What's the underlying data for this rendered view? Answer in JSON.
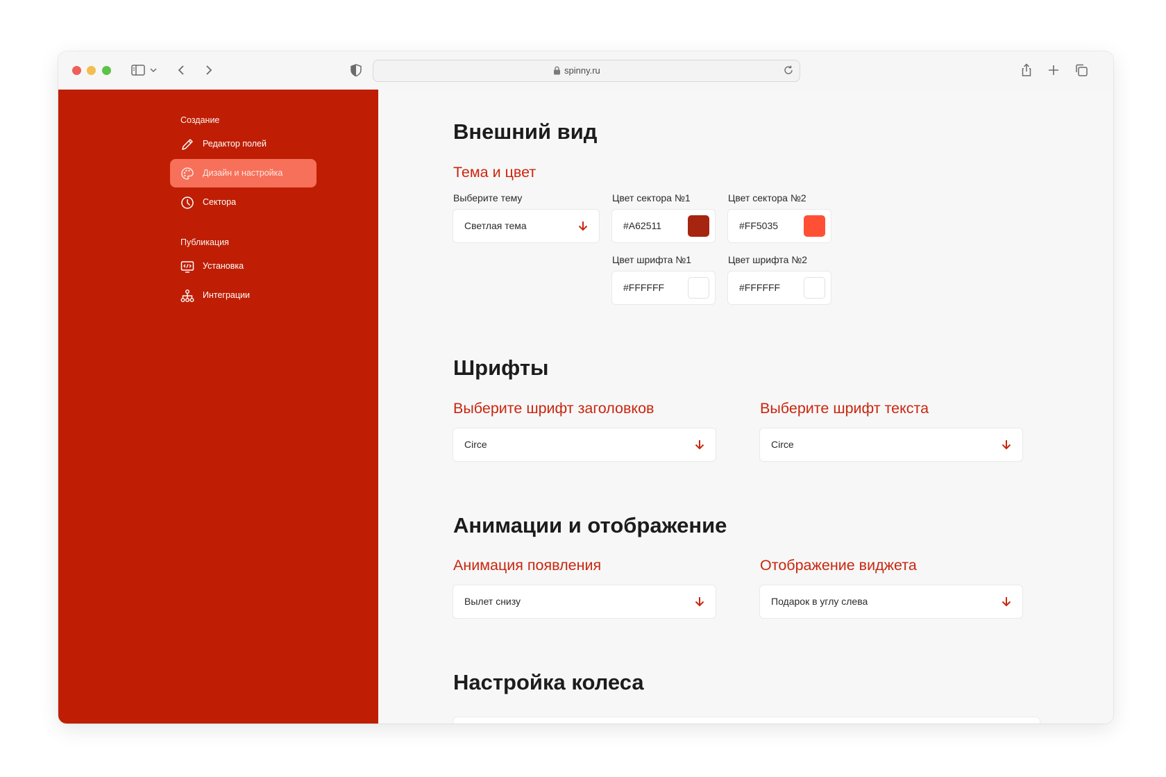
{
  "browser": {
    "url": "spinny.ru"
  },
  "sidebar": {
    "sections": [
      {
        "title": "Создание",
        "items": [
          {
            "label": "Редактор полей",
            "icon": "pencil-icon",
            "active": false
          },
          {
            "label": "Дизайн и настройка",
            "icon": "palette-icon",
            "active": true
          },
          {
            "label": "Сектора",
            "icon": "clock-icon",
            "active": false
          }
        ]
      },
      {
        "title": "Публикация",
        "items": [
          {
            "label": "Установка",
            "icon": "code-monitor-icon",
            "active": false
          },
          {
            "label": "Интеграции",
            "icon": "network-icon",
            "active": false
          }
        ]
      }
    ]
  },
  "appearance": {
    "title": "Внешний вид",
    "theme_title": "Тема и цвет",
    "theme_label": "Выберите тему",
    "theme_value": "Светлая тема",
    "sector1_label": "Цвет сектора №1",
    "sector1_value": "#A62511",
    "sector1_color": "#A62511",
    "sector2_label": "Цвет сектора №2",
    "sector2_value": "#FF5035",
    "sector2_color": "#FF5035",
    "font1_label": "Цвет шрифта №1",
    "font1_value": "#FFFFFF",
    "font1_color": "#FFFFFF",
    "font2_label": "Цвет шрифта №2",
    "font2_value": "#FFFFFF",
    "font2_color": "#FFFFFF"
  },
  "fonts": {
    "title": "Шрифты",
    "heading_label": "Выберите шрифт заголовков",
    "heading_value": "Circe",
    "text_label": "Выберите шрифт текста",
    "text_value": "Circe"
  },
  "animation": {
    "title": "Анимации и отображение",
    "appear_label": "Анимация появления",
    "appear_value": "Вылет снизу",
    "widget_label": "Отображение виджета",
    "widget_value": "Подарок в углу слева"
  },
  "wheel": {
    "title": "Настройка колеса"
  },
  "colors": {
    "sidebar_bg": "#BF1E04",
    "active_item_bg": "#F7705A",
    "accent": "#C9260F"
  }
}
